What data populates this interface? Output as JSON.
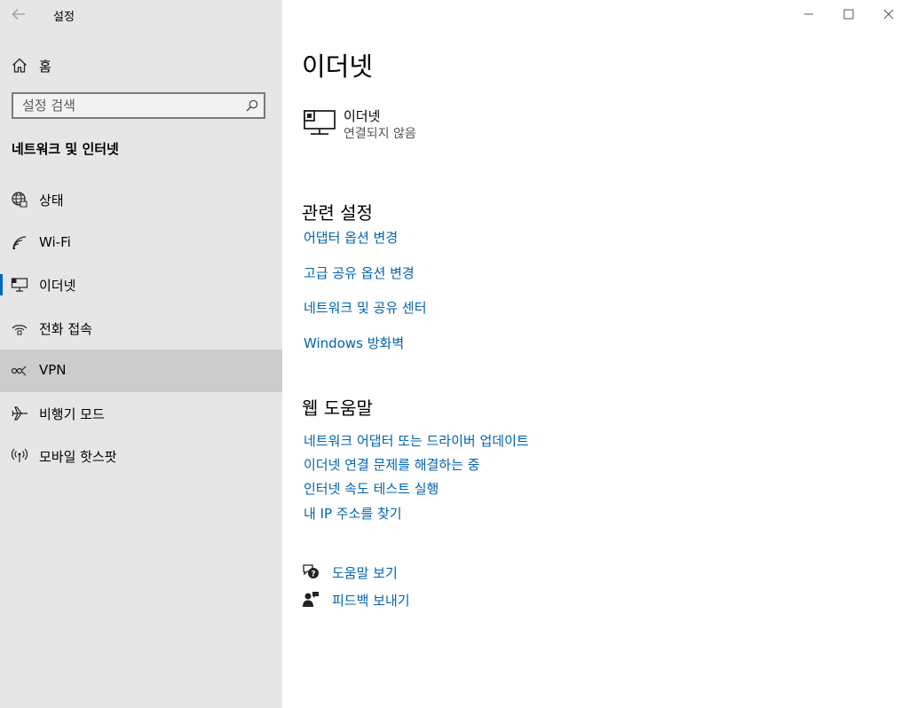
{
  "app": {
    "title": "설정"
  },
  "sidebar": {
    "home_label": "홈",
    "search_placeholder": "설정 검색",
    "section_title": "네트워크 및 인터넷",
    "items": [
      {
        "label": "상태",
        "icon": "status-globe-icon"
      },
      {
        "label": "Wi-Fi",
        "icon": "wifi-icon"
      },
      {
        "label": "이더넷",
        "icon": "ethernet-icon",
        "selected": true
      },
      {
        "label": "전화 접속",
        "icon": "dialup-icon"
      },
      {
        "label": "VPN",
        "icon": "vpn-icon",
        "hovered": true
      },
      {
        "label": "비행기 모드",
        "icon": "airplane-icon"
      },
      {
        "label": "모바일 핫스팟",
        "icon": "hotspot-icon"
      }
    ]
  },
  "main": {
    "title": "이더넷",
    "adapter": {
      "name": "이더넷",
      "status": "연결되지 않음"
    },
    "related_heading": "관련 설정",
    "related_links": [
      "어댑터 옵션 변경",
      "고급 공유 옵션 변경",
      "네트워크 및 공유 센터",
      "Windows 방화벽"
    ],
    "web_help_heading": "웹 도움말",
    "web_help_links": [
      "네트워크 어댑터 또는 드라이버 업데이트",
      "이더넷 연결 문제를 해결하는 중",
      "인터넷 속도 테스트 실행",
      "내 IP 주소를 찾기"
    ],
    "get_help": "도움말 보기",
    "feedback": "피드백 보내기"
  },
  "colors": {
    "accent": "#0063b1",
    "sidebar_bg": "#e6e6e6",
    "hover_bg": "#cccccc",
    "selection_bar": "#0067c0"
  }
}
